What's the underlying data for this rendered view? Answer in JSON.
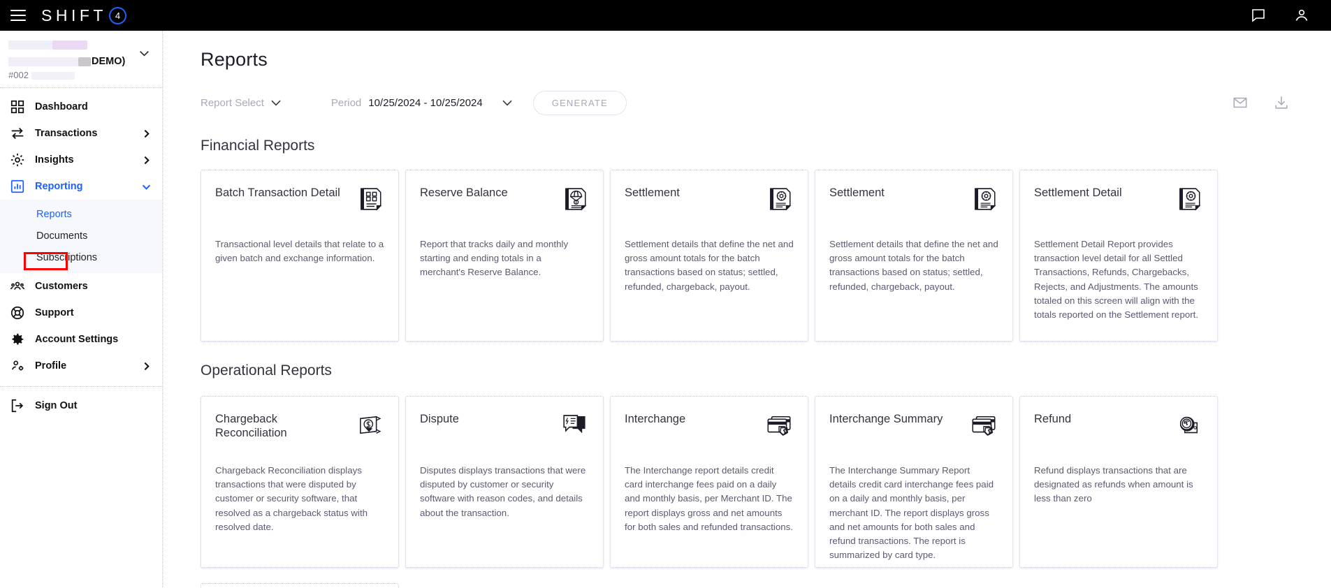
{
  "topbar": {
    "menu_icon": "hamburger-icon",
    "brand_text": "SHIFT",
    "brand_badge": "4",
    "chat_icon": "chat-bubble-icon",
    "account_icon": "user-account-icon"
  },
  "account_switcher": {
    "line2_visible_text": "DEMO)",
    "account_id": "#002",
    "chevron": "chevron-down-icon",
    "redacted": true
  },
  "sidebar": {
    "items": [
      {
        "label": "Dashboard",
        "icon": "dashboard-grid-icon",
        "active": false,
        "expandable": false
      },
      {
        "label": "Transactions",
        "icon": "transactions-arrows-icon",
        "active": false,
        "expandable": true
      },
      {
        "label": "Insights",
        "icon": "insights-sparkle-icon",
        "active": false,
        "expandable": true
      },
      {
        "label": "Reporting",
        "icon": "reporting-chart-icon",
        "active": true,
        "expandable": true
      }
    ],
    "submenu": [
      {
        "label": "Reports",
        "current": true,
        "annotated": true
      },
      {
        "label": "Documents",
        "current": false,
        "annotated": false
      },
      {
        "label": "Subscriptions",
        "current": false,
        "annotated": false
      }
    ],
    "items_lower": [
      {
        "label": "Customers",
        "icon": "customers-people-icon",
        "active": false,
        "expandable": false
      },
      {
        "label": "Support",
        "icon": "support-lifering-icon",
        "active": false,
        "expandable": false
      },
      {
        "label": "Account Settings",
        "icon": "gear-icon",
        "active": false,
        "expandable": false
      },
      {
        "label": "Profile",
        "icon": "profile-user-gear-icon",
        "active": false,
        "expandable": true
      }
    ],
    "sign_out": {
      "label": "Sign Out",
      "icon": "sign-out-icon"
    }
  },
  "page": {
    "title": "Reports"
  },
  "toolbar": {
    "report_select_placeholder": "Report Select",
    "period_label": "Period",
    "period_value": "10/25/2024 - 10/25/2024",
    "generate_label": "GENERATE",
    "generate_disabled": true,
    "email_icon": "envelope-icon",
    "download_icon": "download-icon"
  },
  "sections": [
    {
      "title": "Financial Reports",
      "cards": [
        {
          "title": "Batch Transaction Detail",
          "icon": "document-grid-icon",
          "desc": "Transactional level details that relate to a given batch and exchange information."
        },
        {
          "title": "Reserve Balance",
          "icon": "document-parachute-dollar-icon",
          "desc": "Report that tracks daily and monthly starting and ending totals in a merchant's Reserve Balance."
        },
        {
          "title": "Settlement",
          "icon": "document-gear-icon",
          "desc": "Settlement details that define the net and gross amount totals for the batch transactions based on status; settled, refunded, chargeback, payout."
        },
        {
          "title": "Settlement",
          "icon": "document-gear-icon",
          "desc": "Settlement details that define the net and gross amount totals for the batch transactions based on status; settled, refunded, chargeback, payout."
        },
        {
          "title": "Settlement Detail",
          "icon": "document-gear-icon",
          "desc": "Settlement Detail Report provides transaction level detail for all Settled Transactions, Refunds, Chargebacks, Rejects, and Adjustments. The amounts totaled on this screen will align with the totals reported on the Settlement report."
        }
      ]
    },
    {
      "title": "Operational Reports",
      "cards": [
        {
          "title": "Chargeback Reconciliation",
          "icon": "flag-dollar-icon",
          "desc": "Chargeback Reconciliation displays transactions that were disputed by customer or security software, that resolved as a chargeback status with resolved date."
        },
        {
          "title": "Dispute",
          "icon": "speech-bubbles-icon",
          "desc": "Disputes displays transactions that were disputed by customer or security software with reason codes, and details about the transaction."
        },
        {
          "title": "Interchange",
          "icon": "credit-card-dollar-tag-icon",
          "desc": "The Interchange report details credit card interchange fees paid on a daily and monthly basis, per Merchant ID. The report displays gross and net amounts for both sales and refunded transactions."
        },
        {
          "title": "Interchange Summary",
          "icon": "credit-card-dollar-tag-icon",
          "desc": "The Interchange Summary Report details credit card interchange fees paid on a daily and monthly basis, per merchant ID. The report displays gross and net amounts for both sales and refund transactions. The report is summarized by card type."
        },
        {
          "title": "Refund",
          "icon": "coin-refund-icon",
          "desc": "Refund displays transactions that are designated as refunds when amount is less than zero"
        }
      ]
    }
  ],
  "colors": {
    "brand_blue": "#1d5fff",
    "annotation_red": "#ff0000",
    "topbar_black": "#000000",
    "card_border": "#c6c6e2",
    "text_dark": "#33333f",
    "text_muted": "#5a5a72",
    "placeholder_grey": "#a9a9bd"
  }
}
